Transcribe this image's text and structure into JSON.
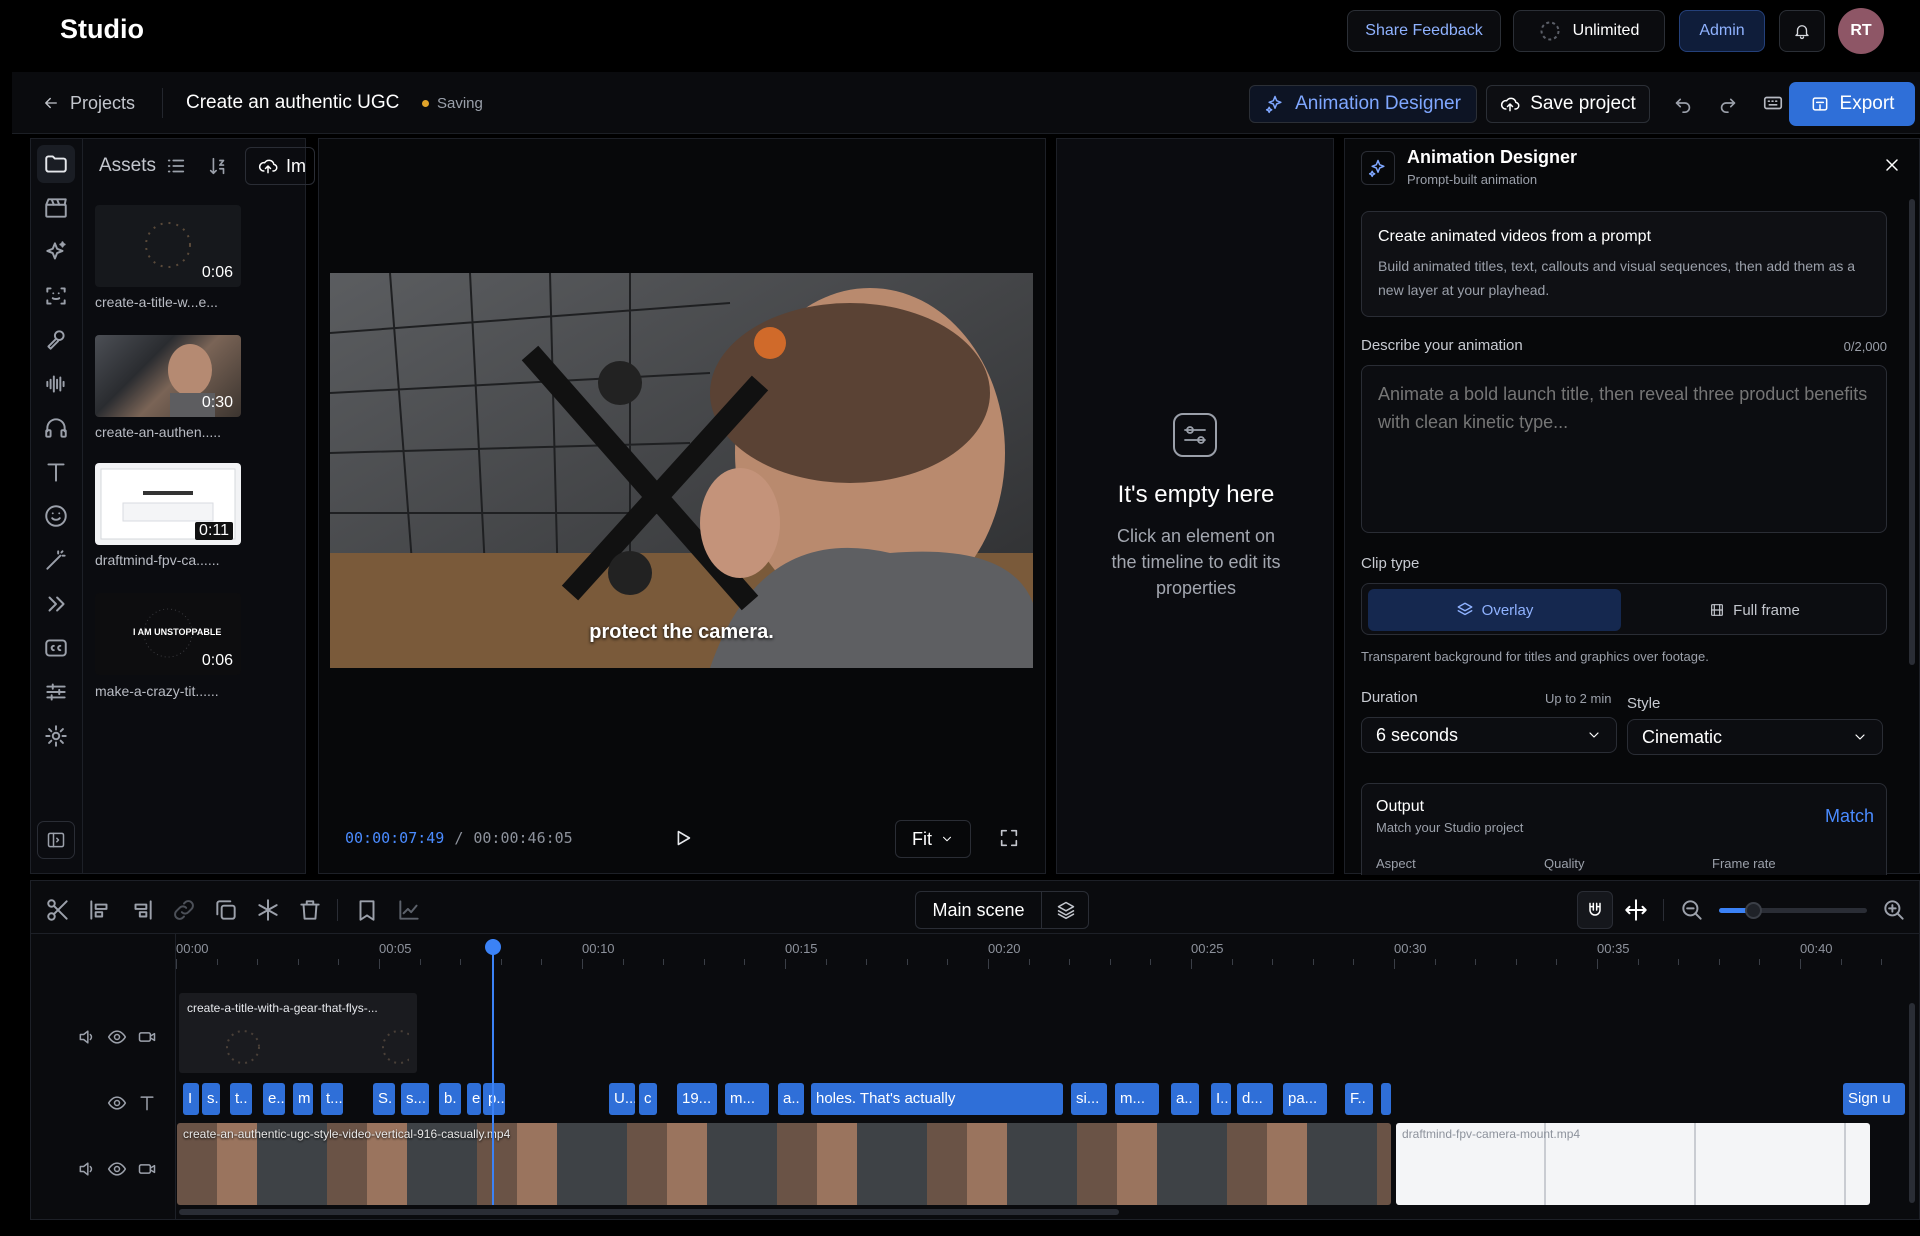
{
  "app": {
    "name": "Studio"
  },
  "topbar": {
    "share_feedback": "Share Feedback",
    "plan": "Unlimited",
    "admin": "Admin",
    "avatar_initials": "RT"
  },
  "project": {
    "back_label": "Projects",
    "title": "Create an authentic UGC",
    "status": "Saving",
    "animation_designer_btn": "Animation Designer",
    "save_btn": "Save project",
    "export_btn": "Export"
  },
  "assets": {
    "tab_label": "Assets",
    "import_label": "Im",
    "items": [
      {
        "name": "create-a-title-w...e...",
        "duration": "0:06"
      },
      {
        "name": "create-an-authen.....",
        "duration": "0:30"
      },
      {
        "name": "draftmind-fpv-ca......",
        "duration": "0:11"
      },
      {
        "name": "make-a-crazy-tit......",
        "duration": "0:06"
      }
    ],
    "thumb4_text": "I AM UNSTOPPABLE"
  },
  "preview": {
    "caption": "protect the camera.",
    "current_time": "00:00:07:49",
    "separator": "/",
    "total_time": "00:00:46:05",
    "fit_label": "Fit"
  },
  "properties": {
    "empty_title": "It's empty here",
    "empty_body": "Click an element on the timeline to edit its properties"
  },
  "animation_designer": {
    "title": "Animation Designer",
    "subtitle": "Prompt-built animation",
    "intro_title": "Create animated videos from a prompt",
    "intro_body": "Build animated titles, text, callouts and visual sequences, then add them as a new layer at your playhead.",
    "describe_label": "Describe your animation",
    "char_count": "0/2,000",
    "prompt_placeholder": "Animate a bold launch title, then reveal three product benefits with clean kinetic type...",
    "clip_type_label": "Clip type",
    "overlay_label": "Overlay",
    "fullframe_label": "Full frame",
    "clip_type_hint": "Transparent background for titles and graphics over footage.",
    "duration_label": "Duration",
    "duration_hint": "Up to 2 min",
    "duration_value": "6 seconds",
    "style_label": "Style",
    "style_value": "Cinematic",
    "output_title": "Output",
    "output_sub": "Match your Studio project",
    "match_label": "Match",
    "aspect_label": "Aspect",
    "quality_label": "Quality",
    "framerate_label": "Frame rate"
  },
  "timeline": {
    "scene_label": "Main scene",
    "ticks": [
      "00:00",
      "00:05",
      "00:10",
      "00:15",
      "00:20",
      "00:25",
      "00:30",
      "00:35",
      "00:40"
    ],
    "overlay_clip_name": "create-a-title-with-a-gear-that-flys-...",
    "video_clip_name": "create-an-authentic-ugc-style-video-vertical-916-casually.mp4",
    "video2_clip_name": "draftmind-fpv-camera-mount.mp4",
    "text_clips": [
      "I",
      "s.",
      "t..",
      "e..",
      "m",
      "t...",
      "S.",
      "s...",
      "b.",
      "e.",
      "p..",
      "U...",
      "c",
      "19...",
      "m...",
      "a..",
      "holes. That's actually",
      "si...",
      "m...",
      "a..",
      "I..",
      "d...",
      "pa...",
      "F..",
      "",
      "Sign u"
    ]
  },
  "colors": {
    "accent": "#2f6fd8",
    "playhead": "#3b82f6",
    "avatar": "#8e5666"
  }
}
